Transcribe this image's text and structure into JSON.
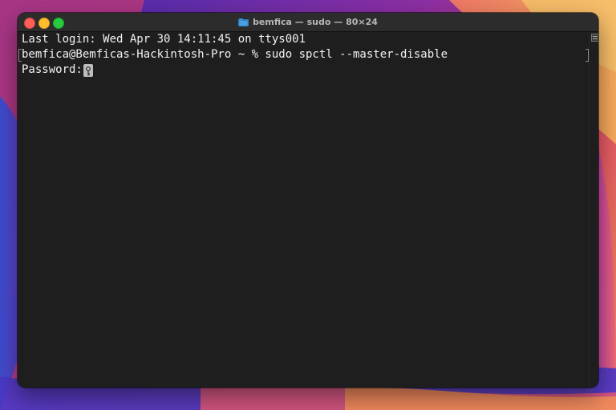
{
  "window": {
    "title": "bemfica — sudo — 80×24",
    "title_icon": "folder-icon"
  },
  "terminal": {
    "lines": [
      "Last login: Wed Apr 30 14:11:45 on ttys001",
      "bemfica@Bemficas-Hackintosh-Pro ~ % sudo spctl --master-disable",
      "Password:"
    ],
    "cursor_icon": "key-icon"
  },
  "colors": {
    "background": "#1e1e1e",
    "titlebar": "#2c2c2c",
    "text": "#f2f2f2",
    "close": "#ff5f57",
    "minimize": "#febc2e",
    "zoom": "#28c840"
  }
}
